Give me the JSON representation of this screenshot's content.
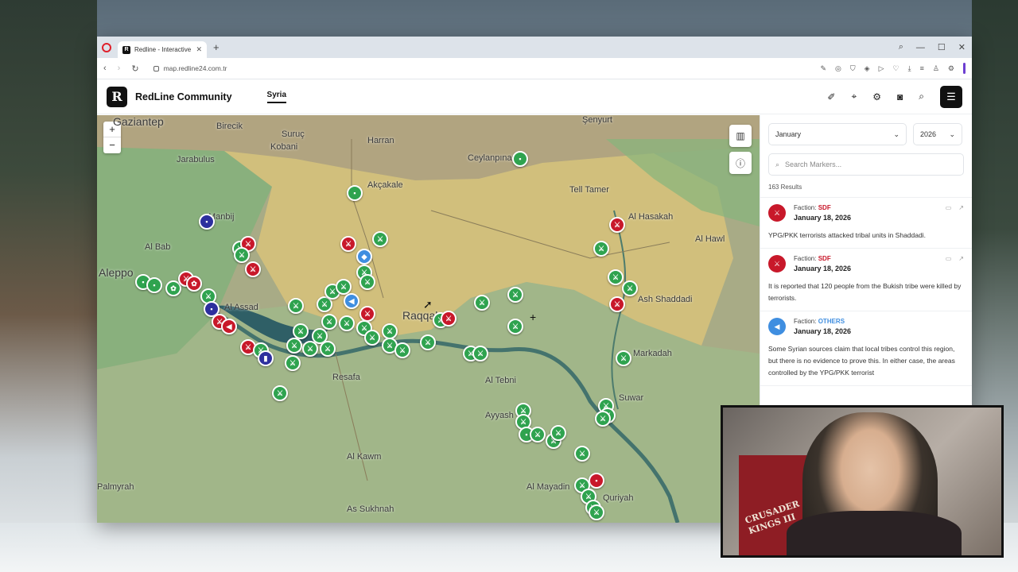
{
  "browser": {
    "tab_title": "Redline - Interactive Strat",
    "url": "map.redline24.com.tr"
  },
  "site": {
    "logo_letter": "R",
    "name": "RedLine Community",
    "nav_active": "Syria"
  },
  "map": {
    "zoom_in": "+",
    "zoom_out": "−",
    "places": [
      {
        "label": "Gaziantep",
        "big": true
      },
      {
        "label": "Birecik",
        "big": false
      },
      {
        "label": "Suruç",
        "big": false
      },
      {
        "label": "Kobani",
        "big": false
      },
      {
        "label": "Harran",
        "big": false
      },
      {
        "label": "Jarabulus",
        "big": false
      },
      {
        "label": "Manbij",
        "big": false
      },
      {
        "label": "Al Bab",
        "big": false
      },
      {
        "label": "Aleppo",
        "big": true
      },
      {
        "label": "Akçakale",
        "big": false
      },
      {
        "label": "Ceylanpınar",
        "big": false
      },
      {
        "label": "Şenyurt",
        "big": false
      },
      {
        "label": "Tell Tamer",
        "big": false
      },
      {
        "label": "Al Hasakah",
        "big": false
      },
      {
        "label": "Al Hawl",
        "big": false
      },
      {
        "label": "Ash Shaddadi",
        "big": false
      },
      {
        "label": "Raqqah",
        "big": true
      },
      {
        "label": "Markadah",
        "big": false
      },
      {
        "label": "Al Tebni",
        "big": false
      },
      {
        "label": "Resafa",
        "big": false
      },
      {
        "label": "Ayyash",
        "big": false
      },
      {
        "label": "Suwar",
        "big": false
      },
      {
        "label": "Al Kawm",
        "big": false
      },
      {
        "label": "Al Mayadin",
        "big": false
      },
      {
        "label": "Quriyah",
        "big": false
      },
      {
        "label": "As Sukhnah",
        "big": false
      },
      {
        "label": "Palmyrah",
        "big": false
      },
      {
        "label": "Al Assad",
        "big": false
      }
    ]
  },
  "panel": {
    "month": "January",
    "year": "2026",
    "search_placeholder": "Search Markers...",
    "results": "163 Results",
    "items": [
      {
        "faction_prefix": "Faction:",
        "faction": "SDF",
        "date": "January 18, 2026",
        "text": "YPG/PKK terrorists attacked tribal units in Shaddadi."
      },
      {
        "faction_prefix": "Faction:",
        "faction": "SDF",
        "date": "January 18, 2026",
        "text": "It is reported that 120 people from the Bukish tribe were killed by terrorists."
      },
      {
        "faction_prefix": "Faction:",
        "faction": "OTHERS",
        "date": "January 18, 2026",
        "text": "Some Syrian sources claim that local tribes control this region, but there is no evidence to prove this. In either case, the areas controlled by the YPG/PKK terrorist"
      }
    ]
  },
  "webcam": {
    "banner_text": "CRUSADER KINGS III"
  },
  "colors": {
    "accent": "#c8182a",
    "sdf": "#c8182a",
    "others": "#3f8ee0",
    "marker_green": "#2fa34f",
    "marker_blue": "#2d2f9e"
  },
  "icons": {
    "header": [
      "pen-tag-icon",
      "location-pin-icon",
      "settings-gear-icon",
      "camera-icon",
      "search-icon",
      "menu-icon"
    ],
    "map_controls": [
      "map-layers-icon",
      "info-icon"
    ]
  }
}
